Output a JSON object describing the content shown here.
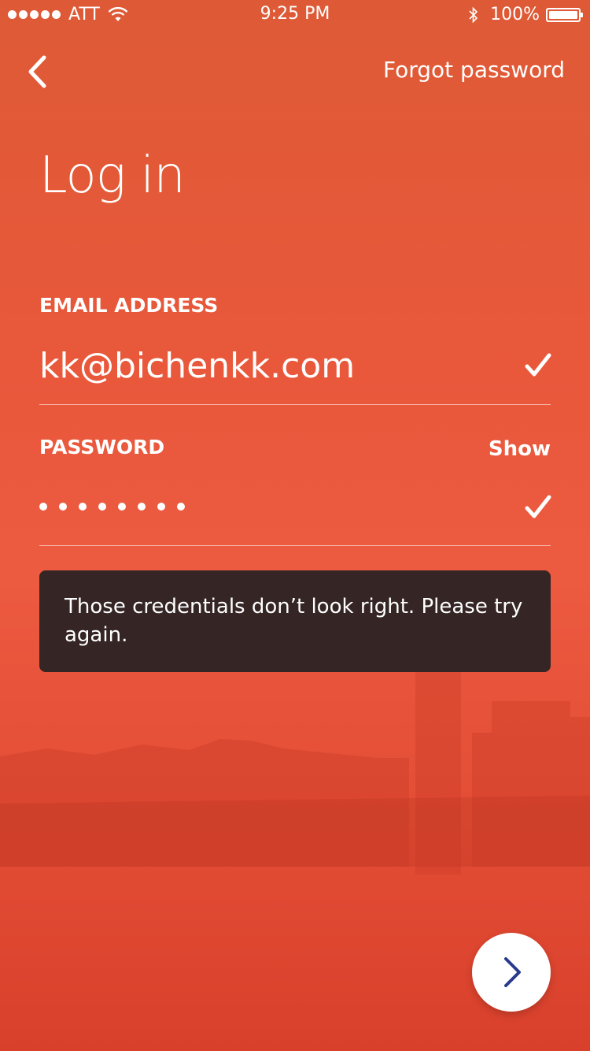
{
  "status_bar": {
    "carrier": "ATT",
    "time": "9:25 PM",
    "battery": "100%",
    "icons": [
      "signal-dots-icon",
      "wifi-icon",
      "bluetooth-icon",
      "battery-icon"
    ]
  },
  "nav": {
    "back_icon": "chevron-left-icon",
    "forgot_label": "Forgot password"
  },
  "title": "Log in",
  "email": {
    "label": "EMAIL ADDRESS",
    "value": "kk@bichenkk.com",
    "valid_icon": "checkmark-icon"
  },
  "password": {
    "label": "PASSWORD",
    "show_label": "Show",
    "masked_length": 8,
    "valid_icon": "checkmark-icon"
  },
  "error": {
    "message": "Those credentials don’t look right. Please try again."
  },
  "next_button": {
    "icon": "chevron-right-icon",
    "icon_color": "#2a3a8c"
  },
  "colors": {
    "background_accent": "#e9583b",
    "toast_background": "#352525"
  }
}
